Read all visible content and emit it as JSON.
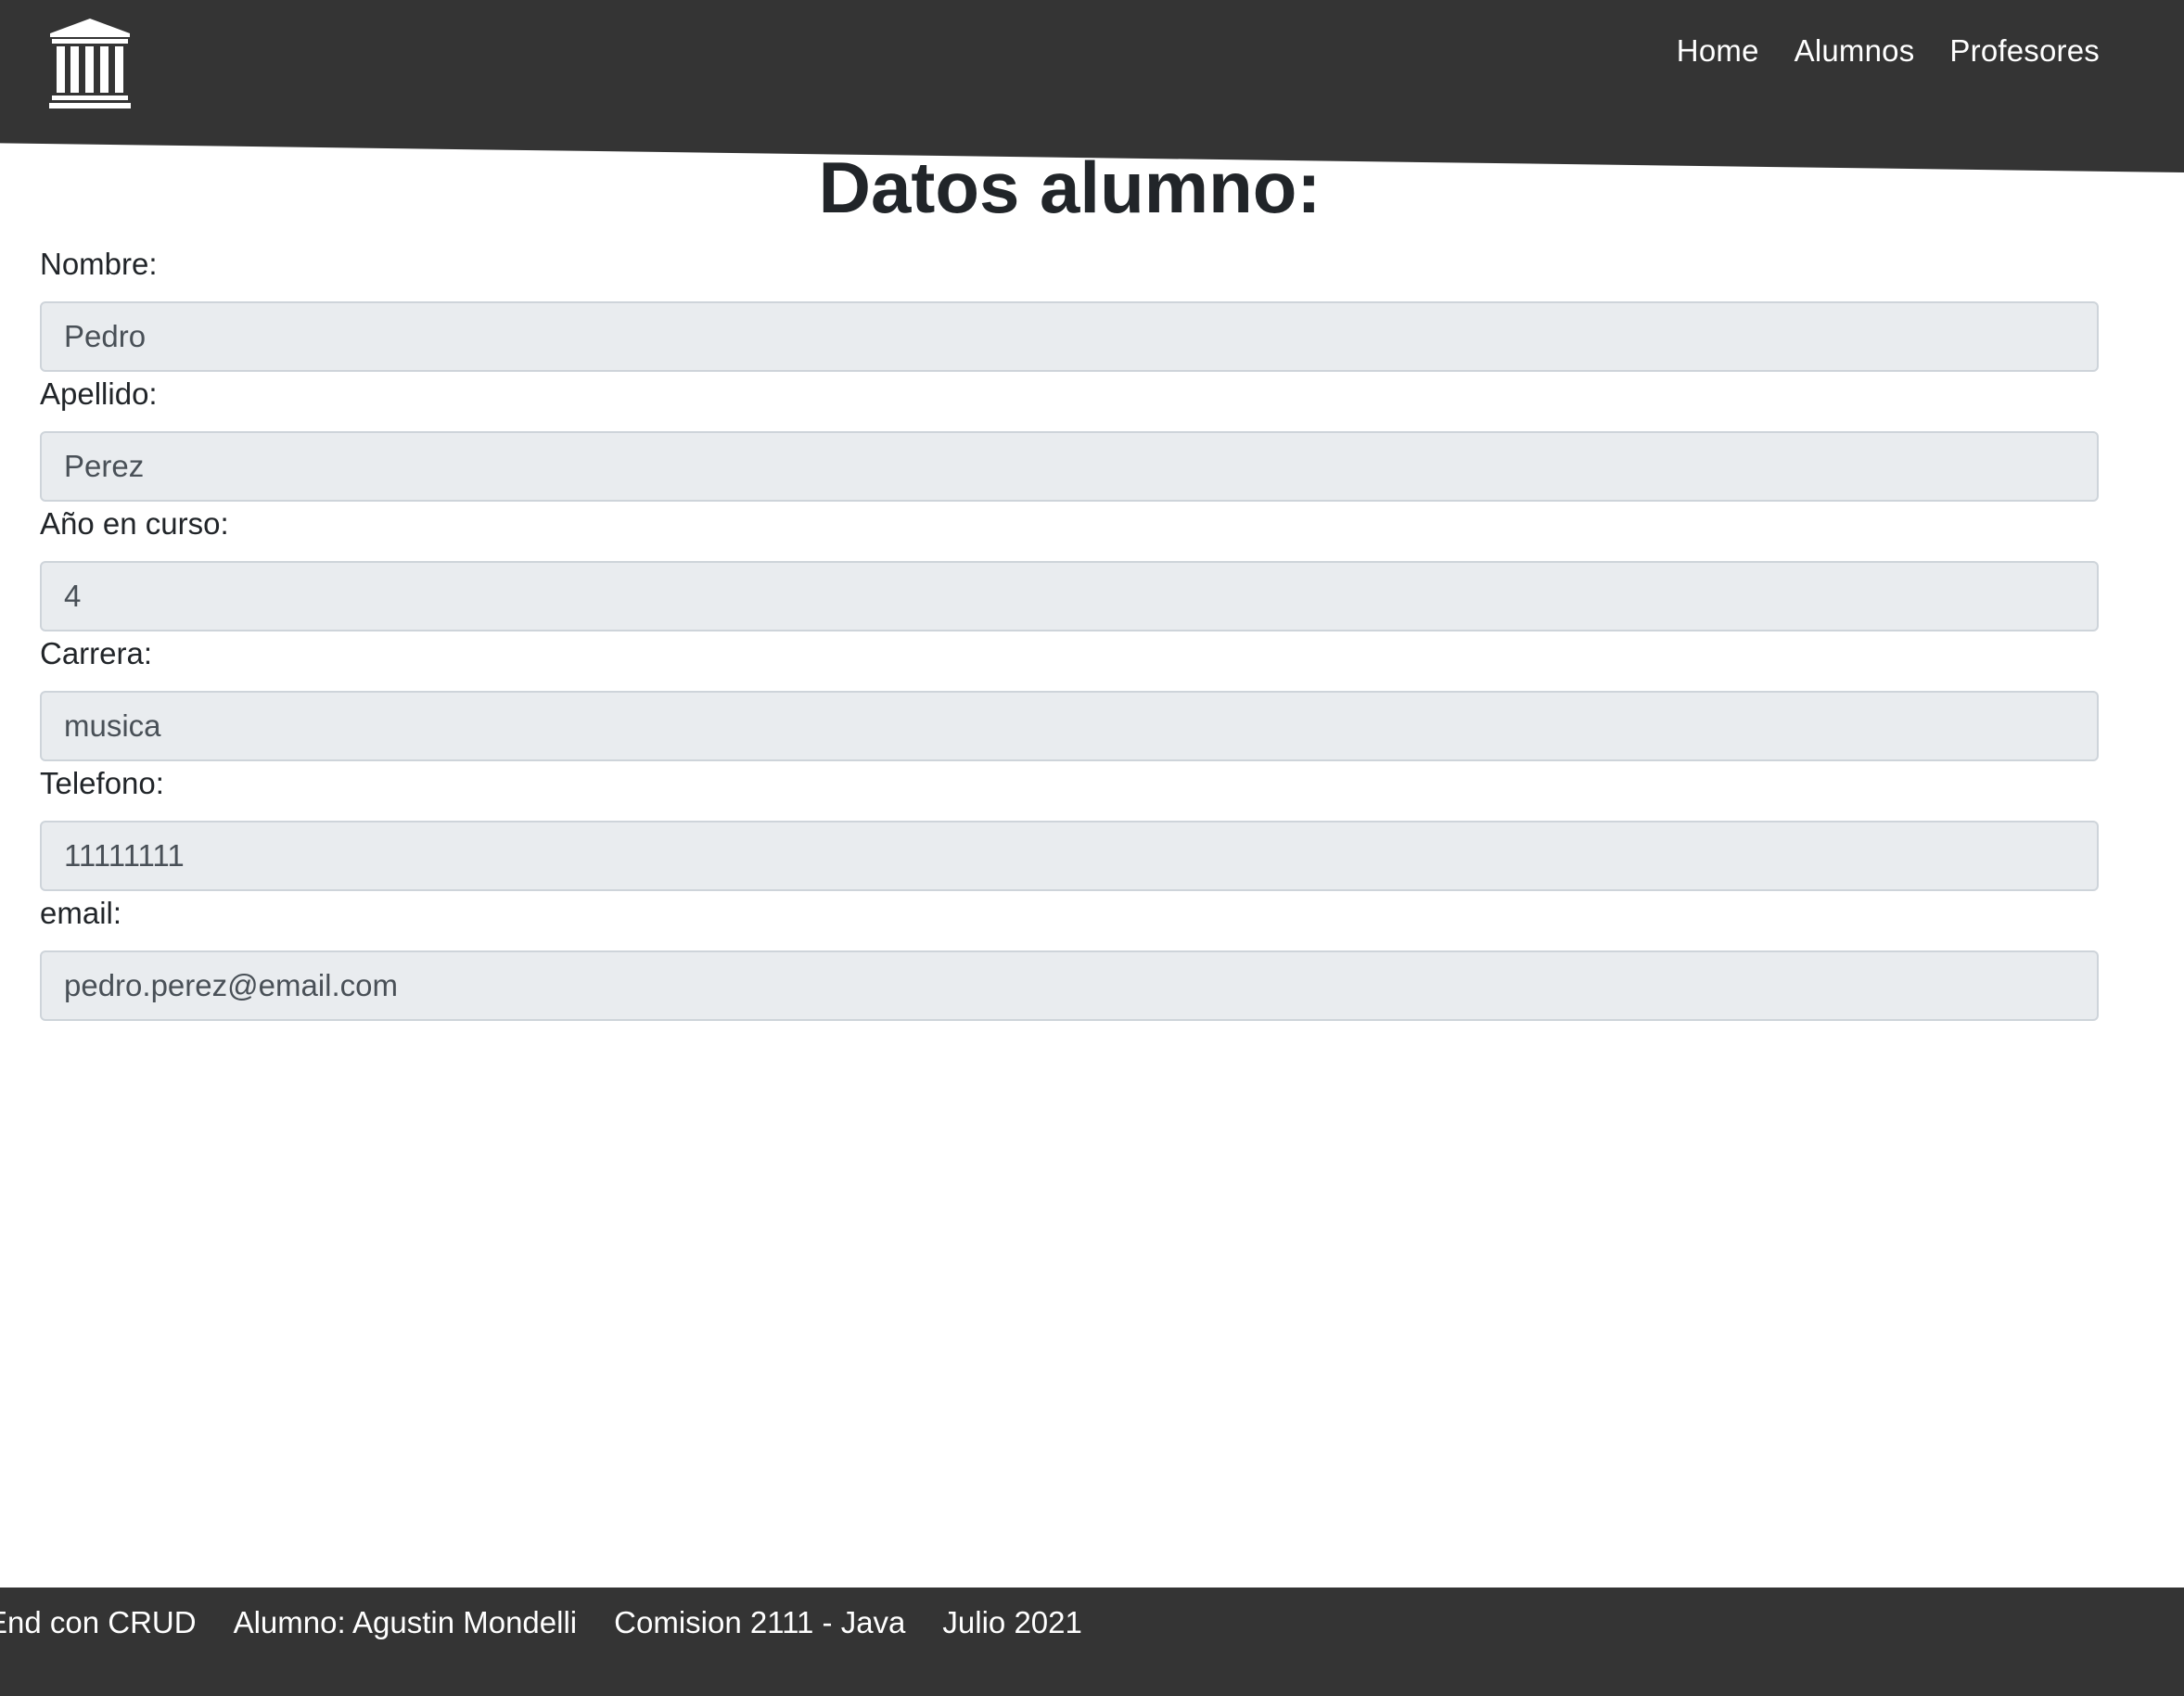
{
  "header": {
    "logo_icon": "classical-building-icon",
    "nav": [
      {
        "label": "Home"
      },
      {
        "label": "Alumnos"
      },
      {
        "label": "Profesores"
      }
    ]
  },
  "main": {
    "title": "Datos alumno:",
    "fields": [
      {
        "label": "Nombre:",
        "value": "Pedro"
      },
      {
        "label": "Apellido:",
        "value": "Perez"
      },
      {
        "label": "Año en curso:",
        "value": "4"
      },
      {
        "label": "Carrera:",
        "value": "musica"
      },
      {
        "label": "Telefono:",
        "value": "11111111"
      },
      {
        "label": "email:",
        "value": "pedro.perez@email.com"
      }
    ]
  },
  "footer": {
    "items": [
      "End con CRUD",
      "Alumno: Agustin Mondelli",
      "Comision 2111 - Java",
      "Julio 2021"
    ]
  },
  "colors": {
    "header_bg": "#343434",
    "input_bg": "#e9ecef",
    "input_border": "#ced4da",
    "text": "#212529"
  }
}
